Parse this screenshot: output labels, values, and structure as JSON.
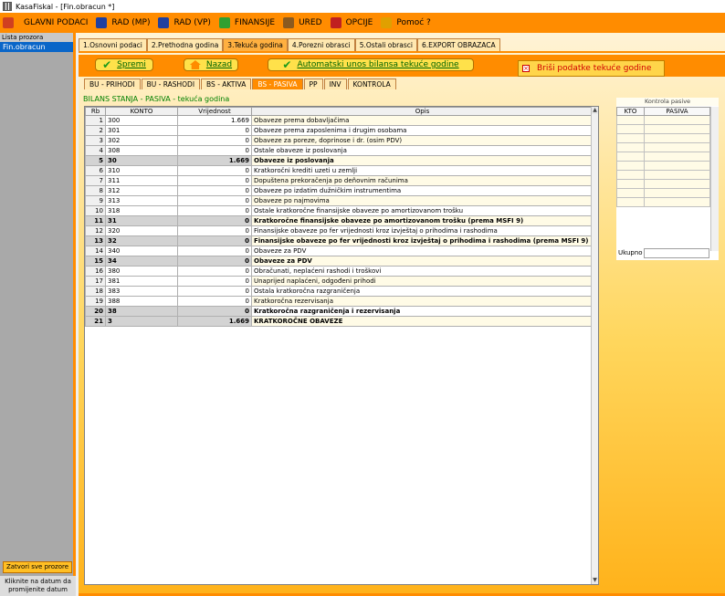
{
  "window": {
    "title": "KasaFiskal  - [Fin.obracun *]"
  },
  "menu": [
    {
      "label": "GLAVNI PODACI",
      "icon": "table-icon",
      "color": "#d04020"
    },
    {
      "label": "RAD (MP)",
      "icon": "flag-icon",
      "color": "#2040a0"
    },
    {
      "label": "RAD (VP)",
      "icon": "flag-icon",
      "color": "#2040a0"
    },
    {
      "label": "FINANSIJE",
      "icon": "coins-icon",
      "color": "#30a030"
    },
    {
      "label": "URED",
      "icon": "briefcase-icon",
      "color": "#8a5a20"
    },
    {
      "label": "OPCIJE",
      "icon": "gear-icon",
      "color": "#c02020"
    },
    {
      "label": "Pomoć ?",
      "icon": "help-icon",
      "color": "#e0a000"
    }
  ],
  "sidebar": {
    "header": "Lista prozora",
    "item": "Fin.obracun",
    "close_all": "Zatvori sve prozore",
    "footer_line1": "Kliknite na datum da",
    "footer_line2": "promijenite datum"
  },
  "top_tabs": [
    {
      "label": "1.Osnovni podaci",
      "active": false
    },
    {
      "label": "2.Prethodna godina",
      "active": false
    },
    {
      "label": "3.Tekuća godina",
      "active": true
    },
    {
      "label": "4.Porezni obrasci",
      "active": false
    },
    {
      "label": "5.Ostali obrasci",
      "active": false
    },
    {
      "label": "6.EXPORT OBRAZACA",
      "active": false
    }
  ],
  "buttons": {
    "save": "Spremi",
    "back": "Nazad",
    "auto": "Automatski unos bilansa tekuće godine",
    "delete": "Briši podatke tekuće godine"
  },
  "sub_tabs": [
    {
      "label": "BU - PRIHODI",
      "active": false
    },
    {
      "label": "BU - RASHODI",
      "active": false
    },
    {
      "label": "BS - AKTIVA",
      "active": false
    },
    {
      "label": "BS - PASIVA",
      "active": true
    },
    {
      "label": "PP",
      "active": false
    },
    {
      "label": "INV",
      "active": false
    },
    {
      "label": "KONTROLA",
      "active": false
    }
  ],
  "section_title": "BILANS STANJA - PASIVA - tekuća godina",
  "table": {
    "headers": [
      "Rb",
      "KONTO",
      "Vrijednost",
      "Opis"
    ],
    "rows": [
      {
        "rb": "1",
        "konto": "300",
        "value": "1.669",
        "desc": "Obaveze prema dobavljačima",
        "bold": false
      },
      {
        "rb": "2",
        "konto": "301",
        "value": "0",
        "desc": "Obaveze prema zaposlenima i drugim osobama",
        "bold": false
      },
      {
        "rb": "3",
        "konto": "302",
        "value": "0",
        "desc": "Obaveze za poreze, doprinose i dr. (osim PDV)",
        "bold": false
      },
      {
        "rb": "4",
        "konto": "308",
        "value": "0",
        "desc": "Ostale obaveze iz poslovanja",
        "bold": false
      },
      {
        "rb": "5",
        "konto": "30",
        "value": "1.669",
        "desc": "Obaveze iz poslovanja",
        "bold": true
      },
      {
        "rb": "6",
        "konto": "310",
        "value": "0",
        "desc": "Kratkoročni krediti uzeti u zemlji",
        "bold": false
      },
      {
        "rb": "7",
        "konto": "311",
        "value": "0",
        "desc": "Dopuštena prekoračenja po deñovnim računima",
        "bold": false
      },
      {
        "rb": "8",
        "konto": "312",
        "value": "0",
        "desc": "Obaveze po izdatim dužničkim instrumentima",
        "bold": false
      },
      {
        "rb": "9",
        "konto": "313",
        "value": "0",
        "desc": "Obaveze po najmovima",
        "bold": false
      },
      {
        "rb": "10",
        "konto": "318",
        "value": "0",
        "desc": "Ostale kratkoročne finansijske obaveze po amortizovanom trošku",
        "bold": false
      },
      {
        "rb": "11",
        "konto": "31",
        "value": "0",
        "desc": "Kratkoročne finansijske obaveze po amortizovanom trošku (prema MSFI 9)",
        "bold": true
      },
      {
        "rb": "12",
        "konto": "320",
        "value": "0",
        "desc": "Finansijske obaveze po fer vrijednosti kroz izvještaj o prihodima i rashodima",
        "bold": false
      },
      {
        "rb": "13",
        "konto": "32",
        "value": "0",
        "desc": "Finansijske obaveze po fer vrijednosti kroz izvještaj o prihodima i rashodima (prema MSFI 9)",
        "bold": true
      },
      {
        "rb": "14",
        "konto": "340",
        "value": "0",
        "desc": "Obaveze za PDV",
        "bold": false
      },
      {
        "rb": "15",
        "konto": "34",
        "value": "0",
        "desc": "Obaveze za PDV",
        "bold": true
      },
      {
        "rb": "16",
        "konto": "380",
        "value": "0",
        "desc": "Obračunati, neplaćeni rashodi i troškovi",
        "bold": false
      },
      {
        "rb": "17",
        "konto": "381",
        "value": "0",
        "desc": "Unaprijed naplaćeni, odgođeni prihodi",
        "bold": false
      },
      {
        "rb": "18",
        "konto": "383",
        "value": "0",
        "desc": "Ostala kratkoročna razgraničenja",
        "bold": false
      },
      {
        "rb": "19",
        "konto": "388",
        "value": "0",
        "desc": "Kratkoročna rezervisanja",
        "bold": false
      },
      {
        "rb": "20",
        "konto": "38",
        "value": "0",
        "desc": "Kratkoročna razgraničenja i rezervisanja",
        "bold": true
      },
      {
        "rb": "21",
        "konto": "3",
        "value": "1.669",
        "desc": "KRATKOROČNE OBAVEZE",
        "bold": true
      }
    ]
  },
  "kontrola": {
    "title": "Kontrola pasive",
    "headers": [
      "KTO",
      "PASIVA"
    ],
    "total_label": "Ukupno"
  }
}
